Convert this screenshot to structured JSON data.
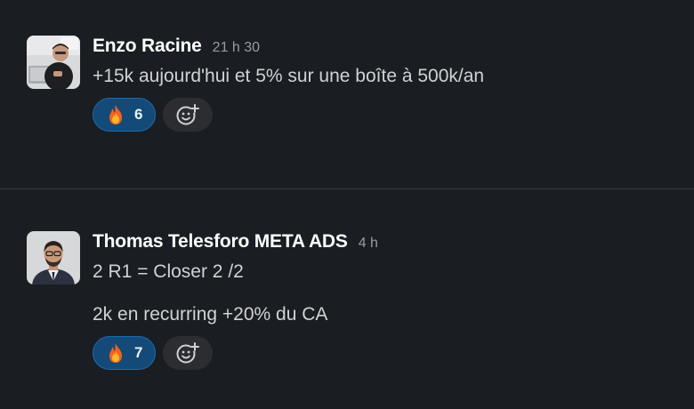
{
  "messages": [
    {
      "author": "Enzo Racine",
      "timestamp": "21 h 30",
      "lines": [
        "+15k aujourd'hui et 5% sur une boîte à 500k/an"
      ],
      "reactions": [
        {
          "emoji": "fire-icon",
          "count": "6"
        }
      ]
    },
    {
      "author": "Thomas Telesforo META ADS",
      "timestamp": "4 h",
      "lines": [
        "2 R1 = Closer 2 /2",
        "2k en recurring +20% du CA"
      ],
      "reactions": [
        {
          "emoji": "fire-icon",
          "count": "7"
        }
      ]
    }
  ],
  "colors": {
    "background": "#1a1d21",
    "reaction_bg": "#144a78",
    "reaction_border": "#1d6ab0",
    "add_reaction_bg": "#2c2d31",
    "author": "#ffffff",
    "text": "#d1d2d3",
    "timestamp": "#9b9c9e"
  }
}
